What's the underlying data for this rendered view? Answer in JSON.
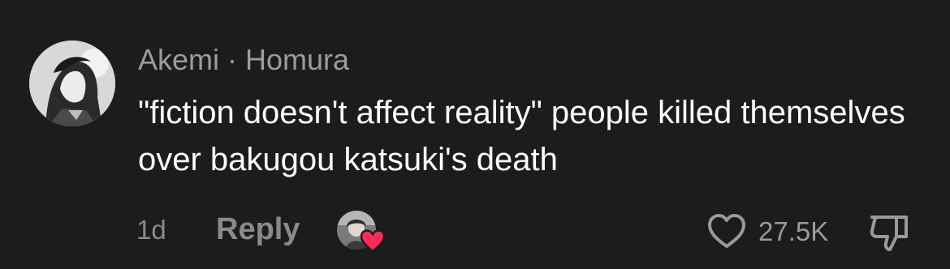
{
  "comment": {
    "author_name": "Akemi",
    "separator": "·",
    "author_subtitle": "Homura",
    "text": "\"fiction doesn't affect reality\" people killed themselves over bakugou katsuki's death",
    "time": "1d",
    "reply_label": "Reply",
    "like_count": "27.5K"
  },
  "icons": {
    "avatar": "user-avatar-icon",
    "creator_like": "creator-liked-heart-icon",
    "like": "heart-outline-icon",
    "dislike": "thumbs-down-icon"
  },
  "colors": {
    "background": "#1c1c1c",
    "text_primary": "#ffffff",
    "text_secondary": "#9c9c9c",
    "heart_badge": "#fe2c55"
  }
}
